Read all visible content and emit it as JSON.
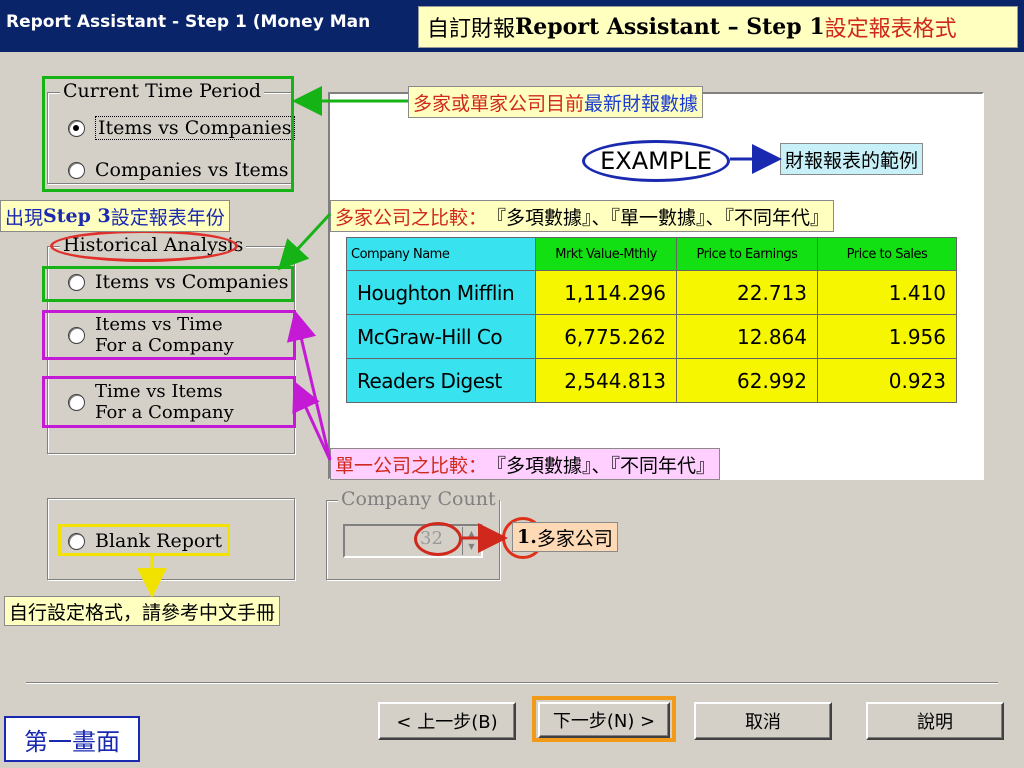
{
  "window": {
    "title": "Report Assistant - Step 1   (Money Man"
  },
  "callouts": {
    "title": {
      "prefix": "自訂財報 ",
      "bold": "Report Assistant – Step 1",
      "suffix": " 設定報表格式"
    },
    "latest_data": {
      "part1": "多家或單家公司目前",
      "part2": "最新財報數據"
    },
    "example_note": "財報報表的範例",
    "step3_note": {
      "p1": "出現 ",
      "bold": "Step 3",
      "p2": " 設定報表年份"
    },
    "multi_company": {
      "red": "多家公司之比較：",
      "black": "『多項數據』、『單一數據』、『不同年代』"
    },
    "single_company": {
      "red": "單一公司之比較：",
      "black": "『多項數據』、『不同年代』"
    },
    "count_note": {
      "num": "1.",
      "text": " 多家公司"
    },
    "blank_note": "自行設定格式，請參考中文手冊",
    "page_label": "第一畫面"
  },
  "current_period": {
    "label": "Current Time Period",
    "options": [
      "Items vs Companies",
      "Companies vs Items"
    ],
    "selected": 0
  },
  "historical": {
    "label": "Historical Analysis",
    "options": [
      {
        "line1": "Items vs Companies",
        "line2": ""
      },
      {
        "line1": "Items vs Time",
        "line2": "For a Company"
      },
      {
        "line1": "Time vs Items",
        "line2": "For a Company"
      }
    ]
  },
  "blank_report": {
    "label": "Blank Report"
  },
  "company_count": {
    "label": "Company Count",
    "value": "32"
  },
  "example": {
    "label": "EXAMPLE",
    "columns": [
      "Company Name",
      "Mrkt Value-Mthly",
      "Price to Earnings",
      "Price to Sales"
    ],
    "rows": [
      [
        "Houghton Mifflin",
        "1,114.296",
        "22.713",
        "1.410"
      ],
      [
        "McGraw-Hill Co",
        "6,775.262",
        "12.864",
        "1.956"
      ],
      [
        "Readers Digest",
        "2,544.813",
        "62.992",
        "0.923"
      ]
    ]
  },
  "buttons": {
    "back": "< 上一步(B)",
    "next": "下一步(N) >",
    "cancel": "取消",
    "help": "說明"
  }
}
